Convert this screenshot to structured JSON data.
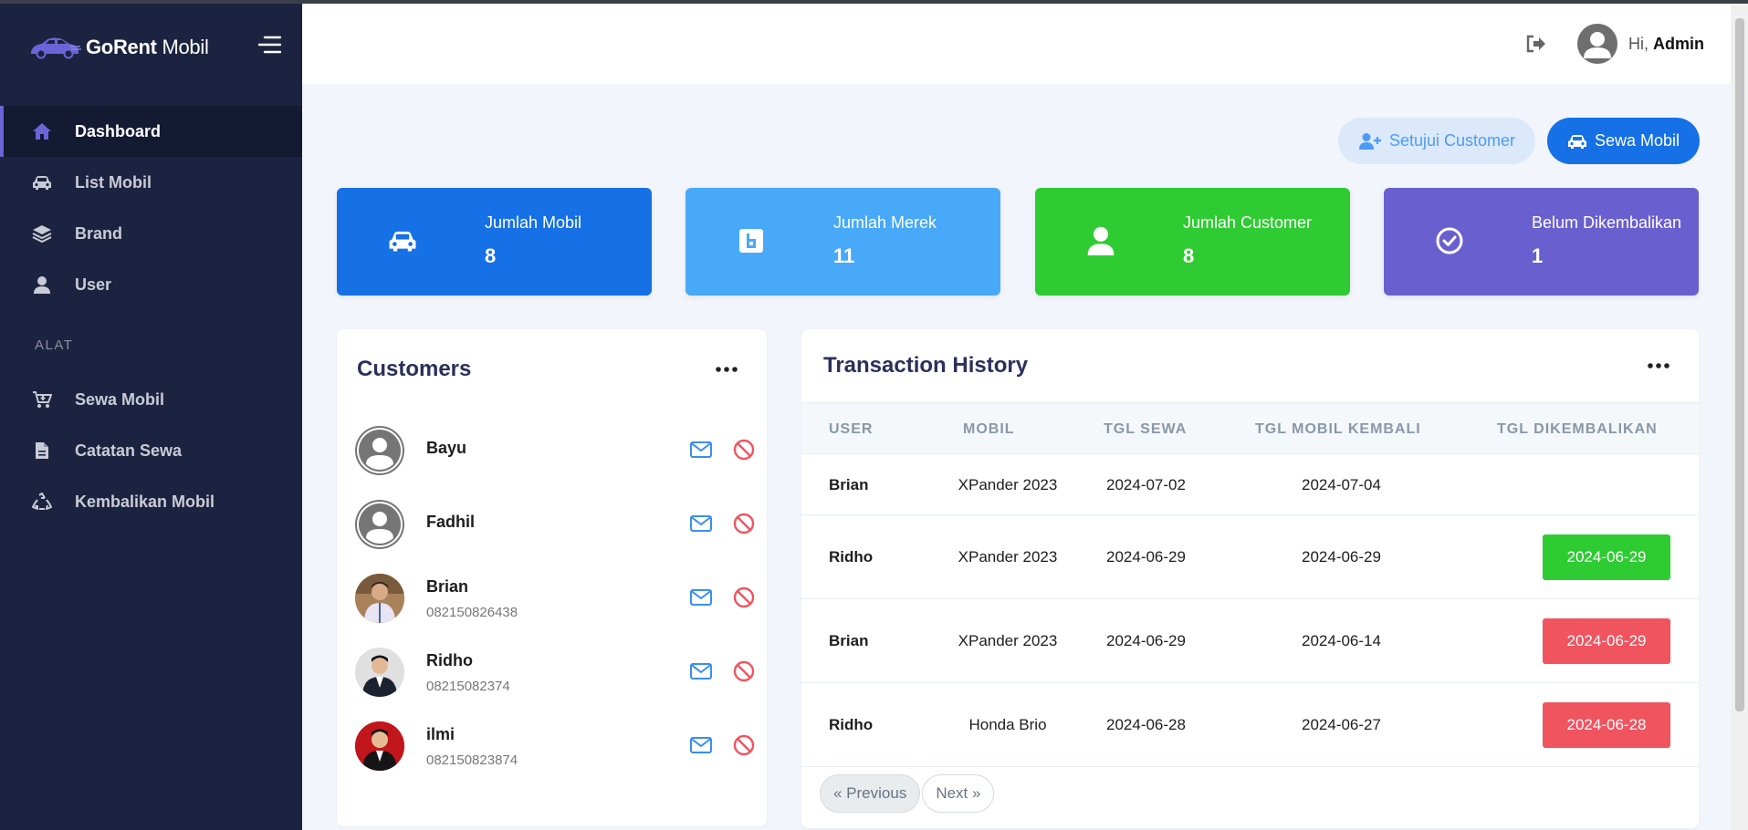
{
  "brand": {
    "name_bold": "GoRent",
    "name_rest": " Mobil"
  },
  "sidebar": {
    "items": [
      {
        "label": "Dashboard",
        "icon": "home-icon"
      },
      {
        "label": "List Mobil",
        "icon": "car-icon"
      },
      {
        "label": "Brand",
        "icon": "layers-icon"
      },
      {
        "label": "User",
        "icon": "user-icon"
      }
    ],
    "section_label": "ALAT",
    "tools": [
      {
        "label": "Sewa Mobil",
        "icon": "cart-icon"
      },
      {
        "label": "Catatan Sewa",
        "icon": "file-icon"
      },
      {
        "label": "Kembalikan Mobil",
        "icon": "recycle-icon"
      }
    ]
  },
  "header": {
    "greeting": "Hi, ",
    "username": "Admin"
  },
  "actions": {
    "approve_label": "Setujui Customer",
    "rent_label": "Sewa Mobil"
  },
  "stats": [
    {
      "label": "Jumlah Mobil",
      "value": "8",
      "color": "#1670e6",
      "icon": "car-icon"
    },
    {
      "label": "Jumlah Merek",
      "value": "11",
      "color": "#48a9f8",
      "icon": "brand-icon"
    },
    {
      "label": "Jumlah Customer",
      "value": "8",
      "color": "#2ecc32",
      "icon": "user-icon"
    },
    {
      "label": "Belum Dikembalikan",
      "value": "1",
      "color": "#6a5fcf",
      "icon": "check-circle-icon"
    }
  ],
  "customers": {
    "title": "Customers",
    "items": [
      {
        "name": "Bayu",
        "phone": ""
      },
      {
        "name": "Fadhil",
        "phone": ""
      },
      {
        "name": "Brian",
        "phone": "082150826438"
      },
      {
        "name": "Ridho",
        "phone": "08215082374"
      },
      {
        "name": "ilmi",
        "phone": "082150823874"
      }
    ]
  },
  "transactions": {
    "title": "Transaction History",
    "columns": [
      "USER",
      "MOBIL",
      "TGL SEWA",
      "TGL MOBIL KEMBALI",
      "TGL DIKEMBALIKAN"
    ],
    "rows": [
      {
        "user": "Brian",
        "car": "XPander 2023",
        "rent_date": "2024-07-02",
        "due_date": "2024-07-04",
        "returned": "",
        "status": "none"
      },
      {
        "user": "Ridho",
        "car": "XPander 2023",
        "rent_date": "2024-06-29",
        "due_date": "2024-06-29",
        "returned": "2024-06-29",
        "status": "ontime"
      },
      {
        "user": "Brian",
        "car": "XPander 2023",
        "rent_date": "2024-06-29",
        "due_date": "2024-06-14",
        "returned": "2024-06-29",
        "status": "late"
      },
      {
        "user": "Ridho",
        "car": "Honda Brio",
        "rent_date": "2024-06-28",
        "due_date": "2024-06-27",
        "returned": "2024-06-28",
        "status": "late"
      }
    ],
    "status_colors": {
      "ontime": "#2ecc32",
      "late": "#f0545f"
    },
    "pager": {
      "prev": "« Previous",
      "next": "Next »"
    }
  }
}
